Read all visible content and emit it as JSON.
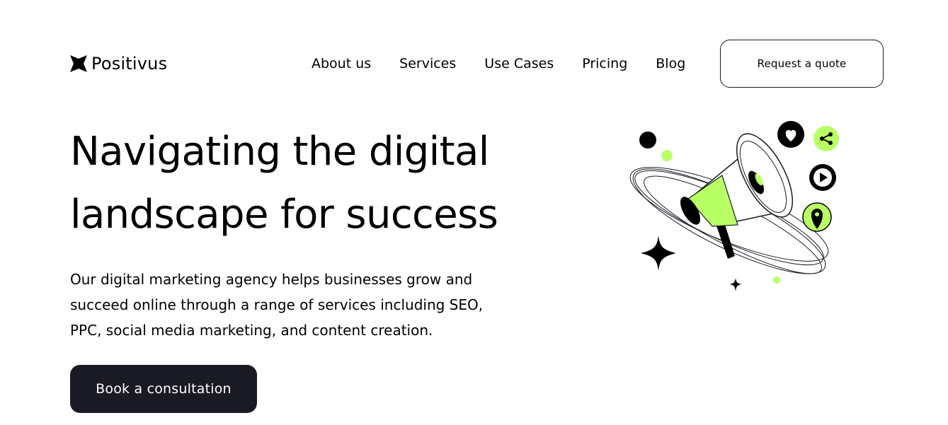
{
  "header": {
    "brand": "Positivus",
    "logo_icon": "star-burst-logo-icon",
    "nav": [
      {
        "label": "About us"
      },
      {
        "label": "Services"
      },
      {
        "label": "Use Cases"
      },
      {
        "label": "Pricing"
      },
      {
        "label": "Blog"
      }
    ],
    "quote_button": "Request a quote"
  },
  "hero": {
    "title_lines": [
      "Navigating the digital",
      "landscape for success"
    ],
    "description_lines": [
      "Our digital marketing agency helps businesses grow and",
      "succeed online through a range of services including SEO,",
      "PPC, social media marketing, and content creation."
    ],
    "cta": "Book a consultation",
    "illustration": {
      "icons": [
        "megaphone-icon",
        "heart-icon",
        "share-icon",
        "play-icon",
        "location-pin-icon",
        "sparkle-star-icon"
      ]
    }
  },
  "colors": {
    "accent": "#b9ff66",
    "dark": "#191a23",
    "background": "#ffffff",
    "text": "#000000"
  }
}
